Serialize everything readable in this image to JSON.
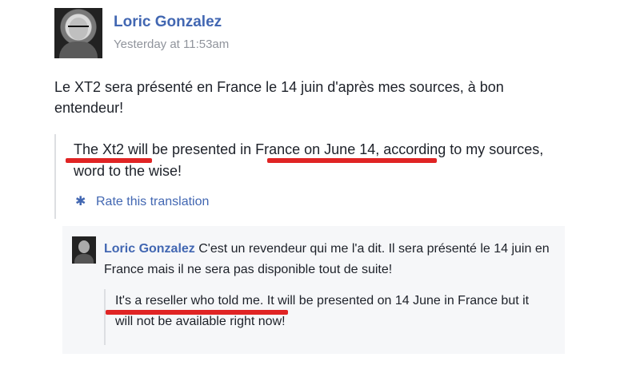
{
  "post": {
    "author": "Loric Gonzalez",
    "timestamp": "Yesterday at 11:53am",
    "text": "Le XT2 sera présenté en France le 14 juin d'après mes sources, à bon entendeur!",
    "translation": "The Xt2 will be presented in France on June 14, according to my sources, word to the wise!",
    "rate_translation": "Rate this translation"
  },
  "comment": {
    "author": "Loric Gonzalez",
    "text": "C'est un revendeur qui me l'a dit. Il sera présenté le 14 juin en France mais il ne sera pas disponible tout de suite!",
    "translation": "It's a reseller who told me. It will be presented on 14 June in France but it will not be available right now!"
  },
  "colors": {
    "link": "#4267b2",
    "secondary_text": "#90949c",
    "highlight_underline": "#e02424"
  },
  "icons": {
    "rate": "gear-icon"
  }
}
